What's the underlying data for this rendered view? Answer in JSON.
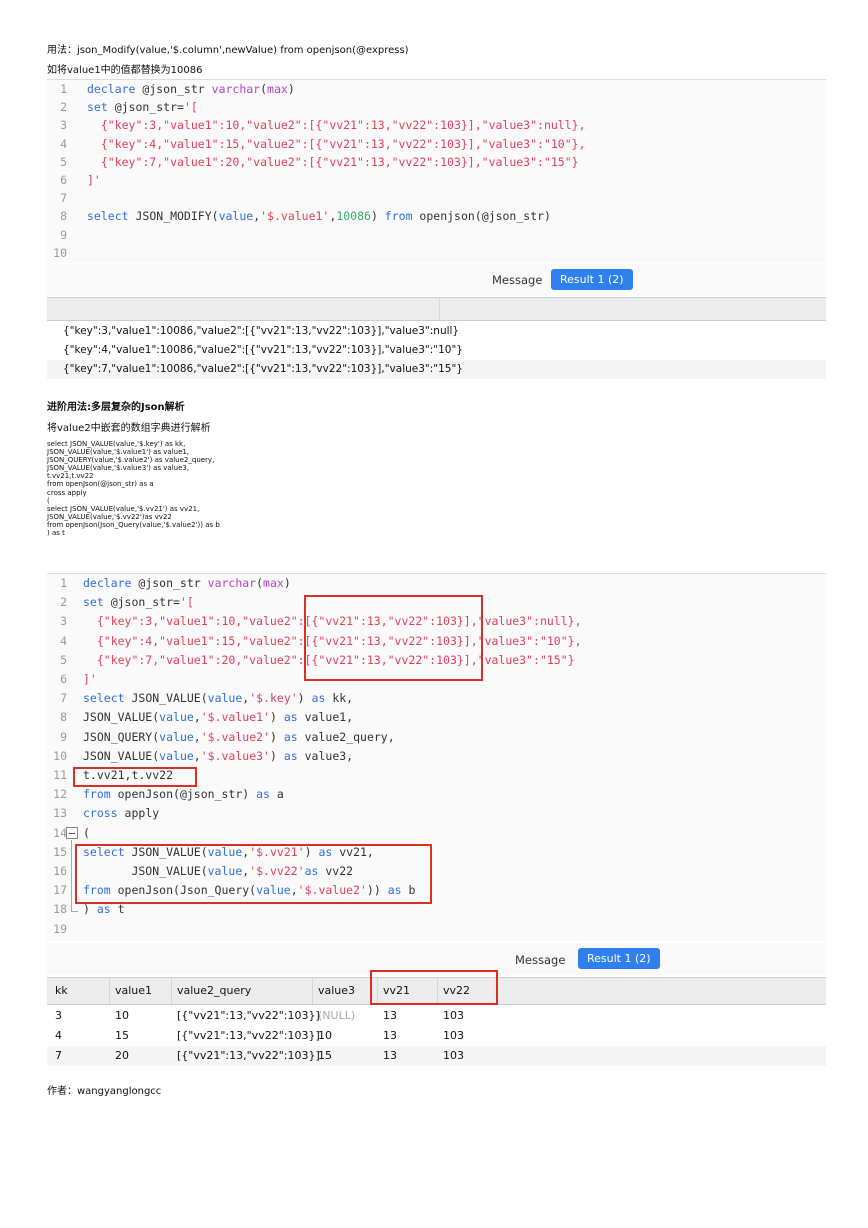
{
  "intro": {
    "usage": "用法：json_Modify(value,'$.column',newValue) from openjson(@express)",
    "example": "如将value1中的值都替换为10086"
  },
  "code1": [
    {
      "n": "1",
      "t": [
        [
          "kw",
          "declare"
        ],
        [
          "fn",
          " @json_str "
        ],
        [
          "kw2",
          "varchar"
        ],
        [
          "fn",
          "("
        ],
        [
          "kw2",
          "max"
        ],
        [
          "fn",
          ")"
        ]
      ]
    },
    {
      "n": "2",
      "t": [
        [
          "kw",
          "set"
        ],
        [
          "fn",
          " @json_str="
        ],
        [
          "str",
          "'["
        ]
      ]
    },
    {
      "n": "3",
      "t": [
        [
          "str",
          "  {\"key\":3,\"value1\":10,\"value2\":[{\"vv21\":13,\"vv22\":103}],\"value3\":null},"
        ]
      ]
    },
    {
      "n": "4",
      "t": [
        [
          "str",
          "  {\"key\":4,\"value1\":15,\"value2\":[{\"vv21\":13,\"vv22\":103}],\"value3\":\"10\"},"
        ]
      ]
    },
    {
      "n": "5",
      "t": [
        [
          "str",
          "  {\"key\":7,\"value1\":20,\"value2\":[{\"vv21\":13,\"vv22\":103}],\"value3\":\"15\"}"
        ]
      ]
    },
    {
      "n": "6",
      "t": [
        [
          "str",
          "]'"
        ]
      ]
    },
    {
      "n": "7",
      "t": []
    },
    {
      "n": "8",
      "t": [
        [
          "kw",
          "select"
        ],
        [
          "fn",
          " JSON_MODIFY("
        ],
        [
          "kw",
          "value"
        ],
        [
          "fn",
          ","
        ],
        [
          "str",
          "'$.value1'"
        ],
        [
          "fn",
          ","
        ],
        [
          "num",
          "10086"
        ],
        [
          "fn",
          ") "
        ],
        [
          "kw",
          "from"
        ],
        [
          "fn",
          " openjson(@json_str)"
        ]
      ]
    },
    {
      "n": "9",
      "t": []
    },
    {
      "n": "10",
      "t": []
    }
  ],
  "tabs1": {
    "message": "Message",
    "result": "Result 1 (2)"
  },
  "result1_rows": [
    "{\"key\":3,\"value1\":10086,\"value2\":[{\"vv21\":13,\"vv22\":103}],\"value3\":null}",
    "{\"key\":4,\"value1\":10086,\"value2\":[{\"vv21\":13,\"vv22\":103}],\"value3\":\"10\"}",
    "{\"key\":7,\"value1\":10086,\"value2\":[{\"vv21\":13,\"vv22\":103}],\"value3\":\"15\"}"
  ],
  "advanced": {
    "title": "进阶用法:多层复杂的Json解析",
    "desc": "将value2中嵌套的数组字典进行解析",
    "snippet": "select JSON_VALUE(value,'$.key') as kk,\nJSON_VALUE(value,'$.value1') as value1,\nJSON_QUERY(value,'$.value2') as value2_query,\nJSON_VALUE(value,'$.value3') as value3,\nt.vv21,t.vv22\nfrom openJson(@json_str) as a\ncross apply\n(\nselect JSON_VALUE(value,'$.vv21') as vv21,\nJSON_VALUE(value,'$.vv22')as vv22\nfrom openJson(Json_Query(value,'$.value2')) as b\n) as t"
  },
  "code2": [
    {
      "n": "1",
      "t": [
        [
          "kw",
          "declare"
        ],
        [
          "fn",
          " @json_str "
        ],
        [
          "kw2",
          "varchar"
        ],
        [
          "fn",
          "("
        ],
        [
          "kw2",
          "max"
        ],
        [
          "fn",
          ")"
        ]
      ]
    },
    {
      "n": "2",
      "t": [
        [
          "kw",
          "set"
        ],
        [
          "fn",
          " @json_str="
        ],
        [
          "str",
          "'["
        ]
      ]
    },
    {
      "n": "3",
      "t": [
        [
          "str",
          "  {\"key\":3,\"value1\":10,\"value2\":[{\"vv21\":13,\"vv22\":103}],\"value3\":null},"
        ]
      ]
    },
    {
      "n": "4",
      "t": [
        [
          "str",
          "  {\"key\":4,\"value1\":15,\"value2\":[{\"vv21\":13,\"vv22\":103}],\"value3\":\"10\"},"
        ]
      ]
    },
    {
      "n": "5",
      "t": [
        [
          "str",
          "  {\"key\":7,\"value1\":20,\"value2\":[{\"vv21\":13,\"vv22\":103}],\"value3\":\"15\"}"
        ]
      ]
    },
    {
      "n": "6",
      "t": [
        [
          "str",
          "]'"
        ]
      ]
    },
    {
      "n": "7",
      "t": [
        [
          "kw",
          "select"
        ],
        [
          "fn",
          " JSON_VALUE("
        ],
        [
          "kw",
          "value"
        ],
        [
          "fn",
          ","
        ],
        [
          "str",
          "'$.key'"
        ],
        [
          "fn",
          ") "
        ],
        [
          "kw",
          "as"
        ],
        [
          "fn",
          " kk,"
        ]
      ]
    },
    {
      "n": "8",
      "t": [
        [
          "fn",
          "JSON_VALUE("
        ],
        [
          "kw",
          "value"
        ],
        [
          "fn",
          ","
        ],
        [
          "str",
          "'$.value1'"
        ],
        [
          "fn",
          ") "
        ],
        [
          "kw",
          "as"
        ],
        [
          "fn",
          " value1,"
        ]
      ]
    },
    {
      "n": "9",
      "t": [
        [
          "fn",
          "JSON_QUERY("
        ],
        [
          "kw",
          "value"
        ],
        [
          "fn",
          ","
        ],
        [
          "str",
          "'$.value2'"
        ],
        [
          "fn",
          ") "
        ],
        [
          "kw",
          "as"
        ],
        [
          "fn",
          " value2_query,"
        ]
      ]
    },
    {
      "n": "10",
      "t": [
        [
          "fn",
          "JSON_VALUE("
        ],
        [
          "kw",
          "value"
        ],
        [
          "fn",
          ","
        ],
        [
          "str",
          "'$.value3'"
        ],
        [
          "fn",
          ") "
        ],
        [
          "kw",
          "as"
        ],
        [
          "fn",
          " value3,"
        ]
      ]
    },
    {
      "n": "11",
      "t": [
        [
          "fn",
          "t.vv21,t.vv22"
        ]
      ]
    },
    {
      "n": "12",
      "t": [
        [
          "kw",
          "from"
        ],
        [
          "fn",
          " openJson(@json_str) "
        ],
        [
          "kw",
          "as"
        ],
        [
          "fn",
          " a"
        ]
      ]
    },
    {
      "n": "13",
      "t": [
        [
          "kw",
          "cross"
        ],
        [
          "fn",
          " apply"
        ]
      ]
    },
    {
      "n": "14",
      "t": [
        [
          "fn",
          "("
        ]
      ]
    },
    {
      "n": "15",
      "t": [
        [
          "kw",
          "select"
        ],
        [
          "fn",
          " JSON_VALUE("
        ],
        [
          "kw",
          "value"
        ],
        [
          "fn",
          ","
        ],
        [
          "str",
          "'$.vv21'"
        ],
        [
          "fn",
          ") "
        ],
        [
          "kw",
          "as"
        ],
        [
          "fn",
          " vv21,"
        ]
      ]
    },
    {
      "n": "16",
      "t": [
        [
          "fn",
          "       JSON_VALUE("
        ],
        [
          "kw",
          "value"
        ],
        [
          "fn",
          ","
        ],
        [
          "str",
          "'$.vv22'"
        ],
        [
          "kw",
          "as"
        ],
        [
          "fn",
          " vv22"
        ]
      ]
    },
    {
      "n": "17",
      "t": [
        [
          "kw",
          "from"
        ],
        [
          "fn",
          " openJson(Json_Query("
        ],
        [
          "kw",
          "value"
        ],
        [
          "fn",
          ","
        ],
        [
          "str",
          "'$.value2'"
        ],
        [
          "fn",
          ")) "
        ],
        [
          "kw",
          "as"
        ],
        [
          "fn",
          " b"
        ]
      ]
    },
    {
      "n": "18",
      "t": [
        [
          "fn",
          ") "
        ],
        [
          "kw",
          "as"
        ],
        [
          "fn",
          " t"
        ]
      ]
    },
    {
      "n": "19",
      "t": []
    }
  ],
  "tabs2": {
    "message": "Message",
    "result": "Result 1 (2)"
  },
  "table2": {
    "headers": [
      "kk",
      "value1",
      "value2_query",
      "value3",
      "vv21",
      "vv22"
    ],
    "rows": [
      [
        "3",
        "10",
        "[{\"vv21\":13,\"vv22\":103}]",
        "(NULL)",
        "13",
        "103"
      ],
      [
        "4",
        "15",
        "[{\"vv21\":13,\"vv22\":103}]",
        "10",
        "13",
        "103"
      ],
      [
        "7",
        "20",
        "[{\"vv21\":13,\"vv22\":103}]",
        "15",
        "13",
        "103"
      ]
    ]
  },
  "author": "作者：wangyanglongcc"
}
